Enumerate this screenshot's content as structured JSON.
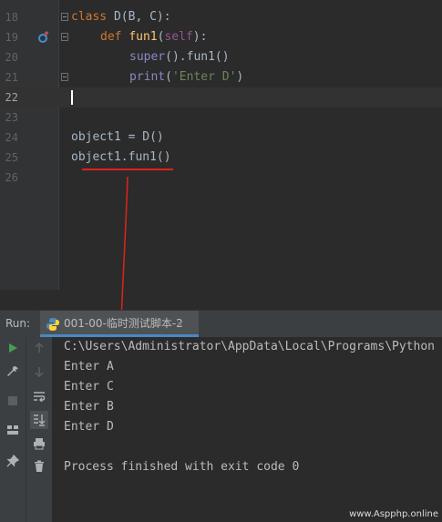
{
  "editor": {
    "lines": [
      {
        "num": "18"
      },
      {
        "num": "19"
      },
      {
        "num": "20"
      },
      {
        "num": "21"
      },
      {
        "num": "22"
      },
      {
        "num": "23"
      },
      {
        "num": "24"
      },
      {
        "num": "25"
      },
      {
        "num": "26"
      }
    ],
    "code": {
      "l18_kw": "class ",
      "l18_rest": "D(B, C):",
      "l19_kw": "def ",
      "l19_fn": "fun1",
      "l19_p1": "(",
      "l19_self": "self",
      "l19_p2": "):",
      "l20_bi": "super",
      "l20_rest": "().fun1()",
      "l21_bi": "print",
      "l21_p1": "(",
      "l21_str": "'Enter D'",
      "l21_p2": ")",
      "l24": "object1 = D()",
      "l25": "object1.fun1()"
    }
  },
  "run": {
    "label": "Run:",
    "tab_title": "001-00-临时测试脚本-2",
    "tab_close": "×"
  },
  "console": {
    "lines": [
      "C:\\Users\\Administrator\\AppData\\Local\\Programs\\Python",
      "Enter A",
      "Enter C",
      "Enter B",
      "Enter D",
      "",
      "Process finished with exit code 0"
    ]
  },
  "watermark": "www.Aspphp.online",
  "colors": {
    "annotation_red": "#e0231b",
    "accent_blue": "#4a88c7",
    "run_green": "#499c54"
  },
  "icons": [
    "fold-icon",
    "override-method-icon",
    "python-icon",
    "run-icon",
    "wrench-icon",
    "stop-icon",
    "layout-icon",
    "pin-icon",
    "arrow-up-icon",
    "arrow-down-icon",
    "soft-wrap-icon",
    "scroll-to-end-icon",
    "print-icon",
    "trash-icon"
  ]
}
